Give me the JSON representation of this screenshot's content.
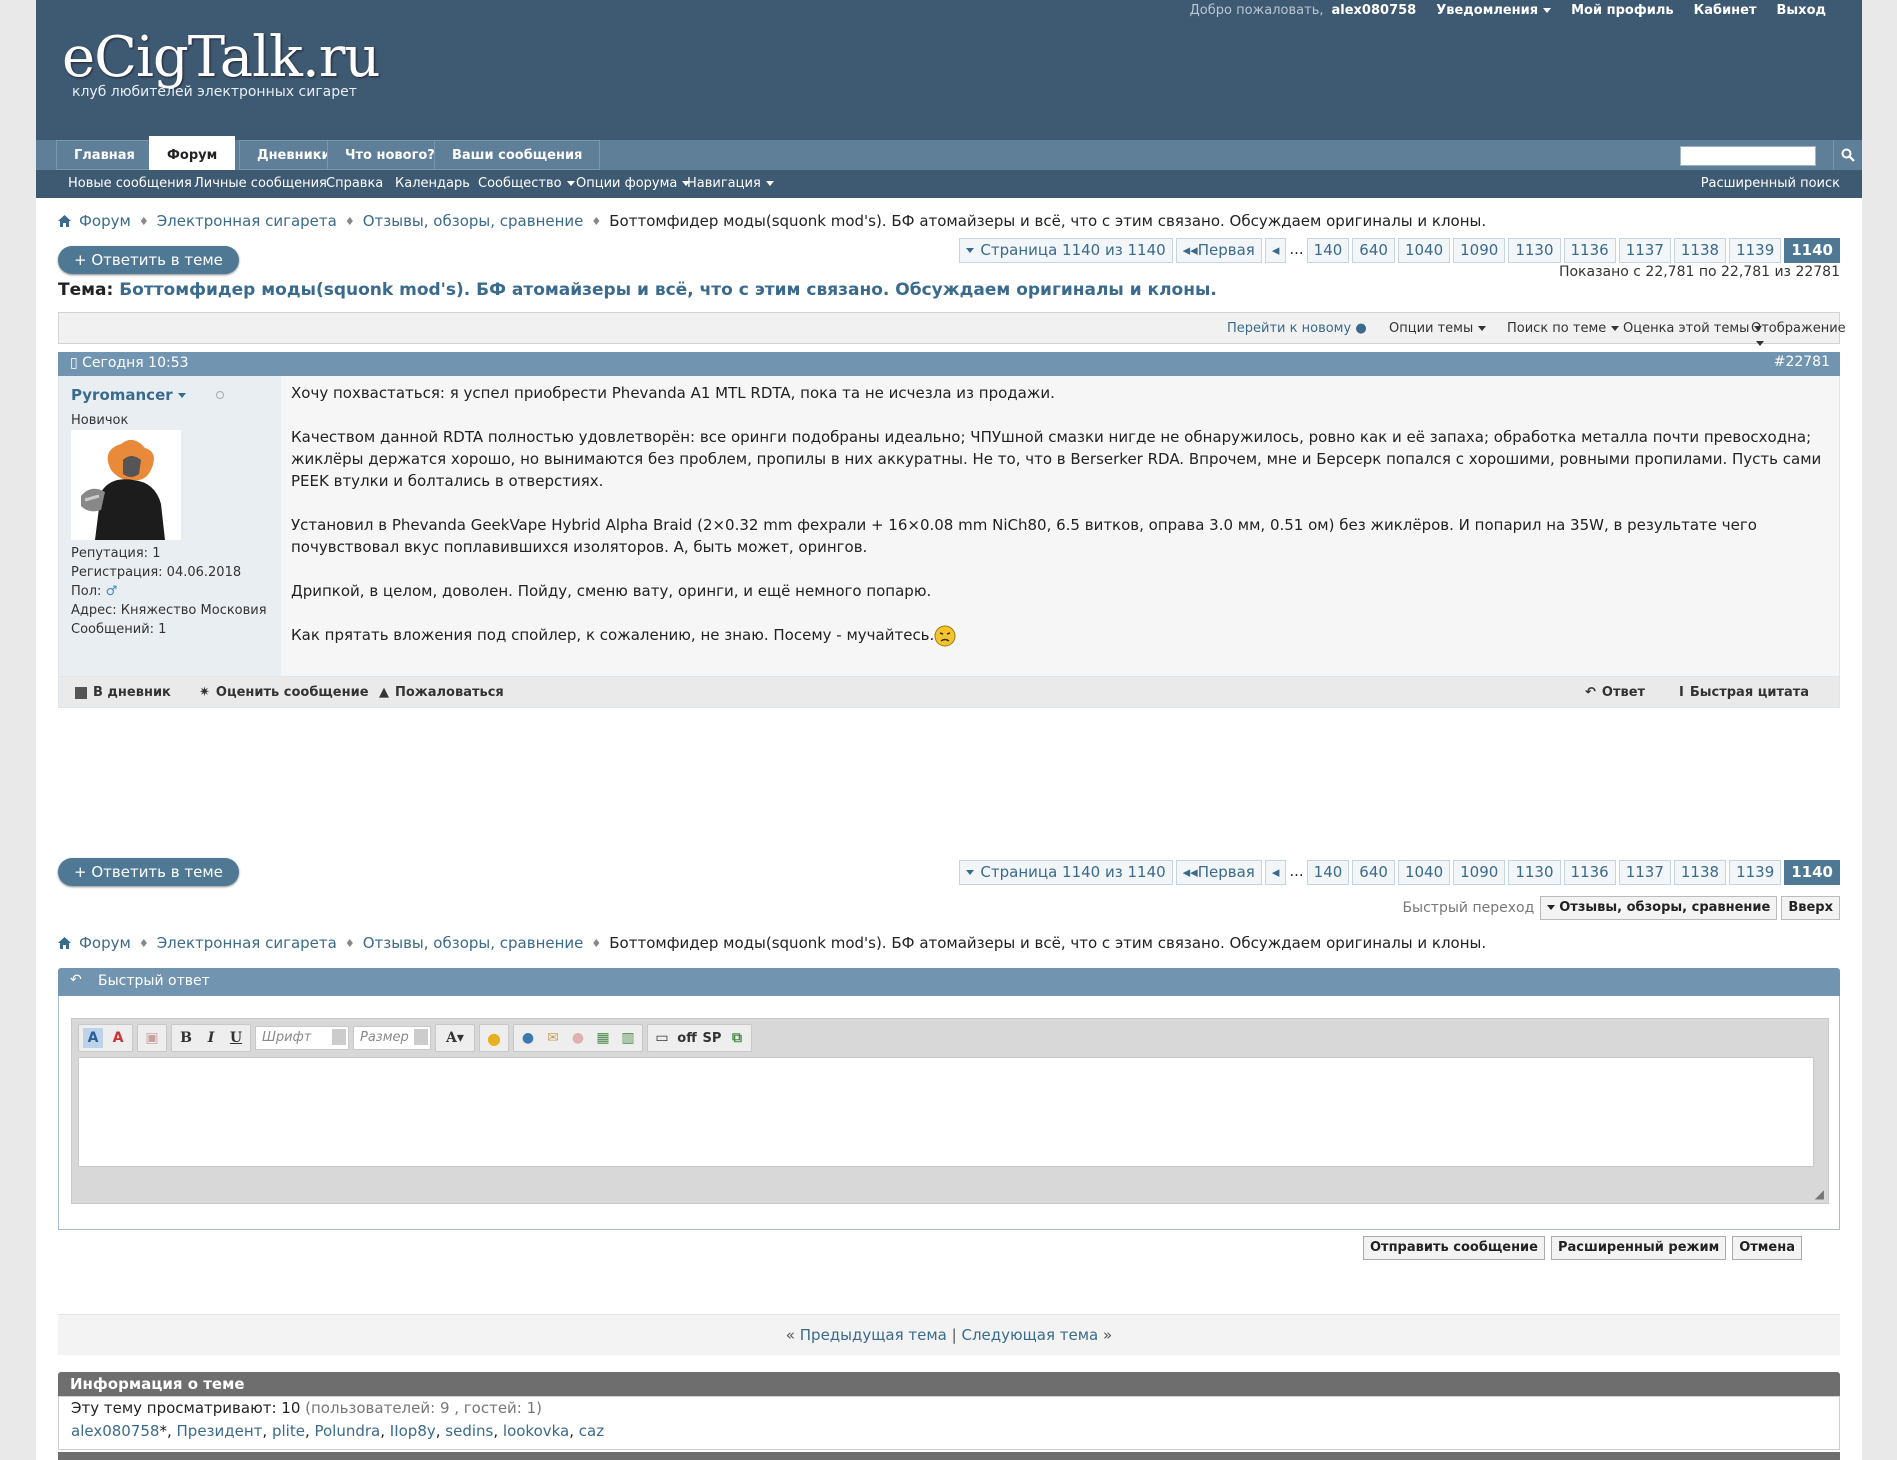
{
  "header": {
    "logo_main": "eCigTalk.ru",
    "logo_sub": "клуб любителей электронных сигарет",
    "welcome": "Добро пожаловать,",
    "username": "alex080758",
    "notifications": "Уведомления",
    "profile": "Мой профиль",
    "cabinet": "Кабинет",
    "logout": "Выход"
  },
  "nav": {
    "tabs": [
      "Главная",
      "Форум",
      "Дневники",
      "Что нового?",
      "Ваши сообщения"
    ],
    "active_tab": "Форум",
    "sub": [
      "Новые сообщения",
      "Личные сообщения",
      "Справка",
      "Календарь",
      "Сообщество",
      "Опции форума",
      "Навигация"
    ],
    "advanced_search": "Расширенный поиск"
  },
  "breadcrumb": [
    "Форум",
    "Электронная сигарета",
    "Отзывы, обзоры, сравнение",
    "Боттомфидер моды(squonk mod's). БФ атомайзеры и всё, что с этим связано. Обсуждаем оригиналы и клоны."
  ],
  "reply_button": "+ Ответить в теме",
  "pager": {
    "label": "Страница 1140 из 1140",
    "first": "Первая",
    "dots": "...",
    "pages": [
      "140",
      "640",
      "1040",
      "1090",
      "1130",
      "1136",
      "1137",
      "1138",
      "1139",
      "1140"
    ],
    "current": "1140"
  },
  "shown": "Показано с 22,781 по 22,781 из 22781",
  "topic": {
    "prefix": "Тема:",
    "title": "Боттомфидер моды(squonk mod's). БФ атомайзеры и всё, что с этим связано. Обсуждаем оригиналы и клоны."
  },
  "tools": {
    "goto_new": "Перейти к новому",
    "thread_options": "Опции темы",
    "search_thread": "Поиск по теме",
    "rate_thread": "Оценка этой темы",
    "display": "Отображение"
  },
  "post": {
    "date": "Сегодня 10:53",
    "number": "#22781",
    "author": "Pyromancer",
    "rank": "Новичок",
    "reputation": "Репутация: 1",
    "registration": "Регистрация: 04.06.2018",
    "gender": "Пол:",
    "address": "Адрес: Княжество Московия",
    "messages": "Сообщений: 1",
    "paragraphs": [
      "Хочу похвастаться: я успел приобрести Phevanda A1 MTL RDTA, пока та не исчезла из продажи.",
      "Качеством данной RDTA полностью удовлетворён: все оринги подобраны идеально; ЧПУшной смазки нигде не обнаружилось, ровно как и её запаха; обработка металла почти превосходна; жиклёры держатся хорошо, но вынимаются без проблем, пропилы в них аккуратны. Не то, что в Berserker RDA. Впрочем, мне и Берсерк попался с хорошими, ровными пропилами. Пусть сами PEEK втулки и болтались в отверстиях.",
      "Установил в Phevanda GeekVape Hybrid Alpha Braid (2×0.32 mm фехрали + 16×0.08 mm NiCh80, 6.5 витков, оправа 3.0 мм, 0.51 ом) без жиклёров. И попарил на 35W, в результате чего почувствовал вкус поплавившихся изоляторов. А, быть может, орингов.",
      "Дрипкой, в целом, доволен. Пойду, сменю вату, оринги, и ещё немного попарю.",
      "Как прятать вложения под спойлер, к сожалению, не знаю. Посему - мучайтесь."
    ],
    "foot": {
      "diary": "В дневник",
      "rate": "Оценить сообщение",
      "report": "Пожаловаться",
      "reply": "Ответ",
      "quick_quote": "Быстрая цитата"
    }
  },
  "jump": {
    "label": "Быстрый переход",
    "forum": "Отзывы, обзоры, сравнение",
    "top": "Вверх"
  },
  "quick_reply": {
    "title": "Быстрый ответ",
    "font_placeholder": "Шрифт",
    "size_placeholder": "Размер",
    "off_label": "off",
    "sp_label": "SP",
    "submit": "Отправить сообщение",
    "advanced": "Расширенный режим",
    "cancel": "Отмена"
  },
  "prevnext": {
    "prev": "Предыдущая тема",
    "next": "Следующая тема",
    "left_quote": "«",
    "right_quote": "»",
    "separator": "|"
  },
  "thread_info": {
    "title": "Информация о теме",
    "viewing": "Эту тему просматривают: 10",
    "viewing_detail": "(пользователей: 9 , гостей: 1)",
    "users": [
      "alex080758",
      "Президент",
      "plite",
      "Polundra",
      "IIop8y",
      "sedins",
      "lookovka",
      "caz"
    ],
    "first_user_suffix": "*"
  },
  "colors": {
    "header_bg": "#3e5a73",
    "nav_bg": "#5f7f99",
    "post_head": "#7194b1",
    "link": "#3a6a8c"
  }
}
